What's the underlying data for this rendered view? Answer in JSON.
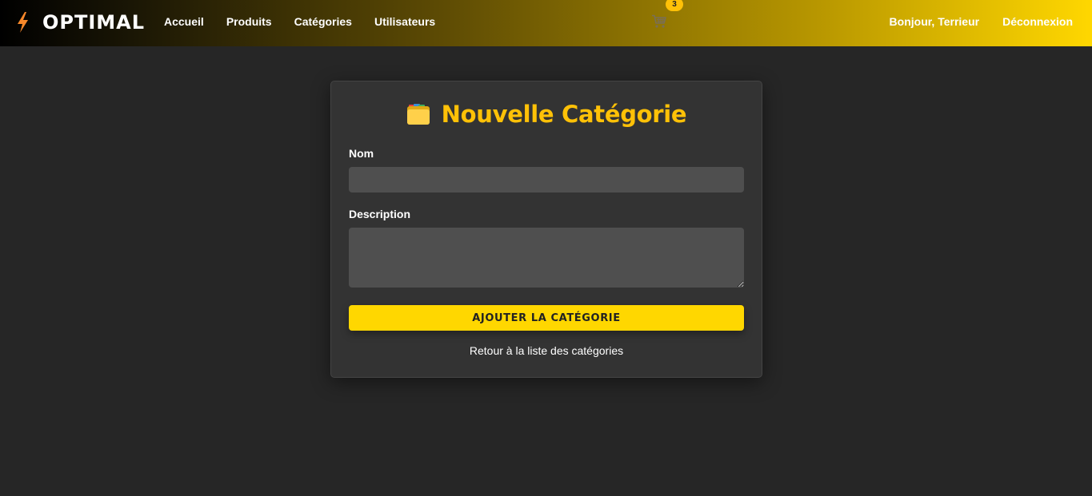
{
  "navbar": {
    "brand": "OPTIMAL",
    "links": [
      "Accueil",
      "Produits",
      "Catégories",
      "Utilisateurs"
    ],
    "cart_count": "3",
    "greeting": "Bonjour, Terrieur",
    "logout": "Déconnexion"
  },
  "form": {
    "title": "Nouvelle Catégorie",
    "name_label": "Nom",
    "name_value": "",
    "description_label": "Description",
    "description_value": "",
    "submit_label": "AJOUTER LA CATÉGORIE",
    "back_link": "Retour à la liste des catégories"
  },
  "icons": {
    "brand": "lightning-bolt-icon",
    "cart": "shopping-cart-icon",
    "title": "folder-icon"
  },
  "colors": {
    "accent": "#ffc107",
    "button": "#ffd700",
    "bolt": "#f7882a",
    "background": "#262626",
    "card": "#333333",
    "input": "#4f4f4f"
  }
}
